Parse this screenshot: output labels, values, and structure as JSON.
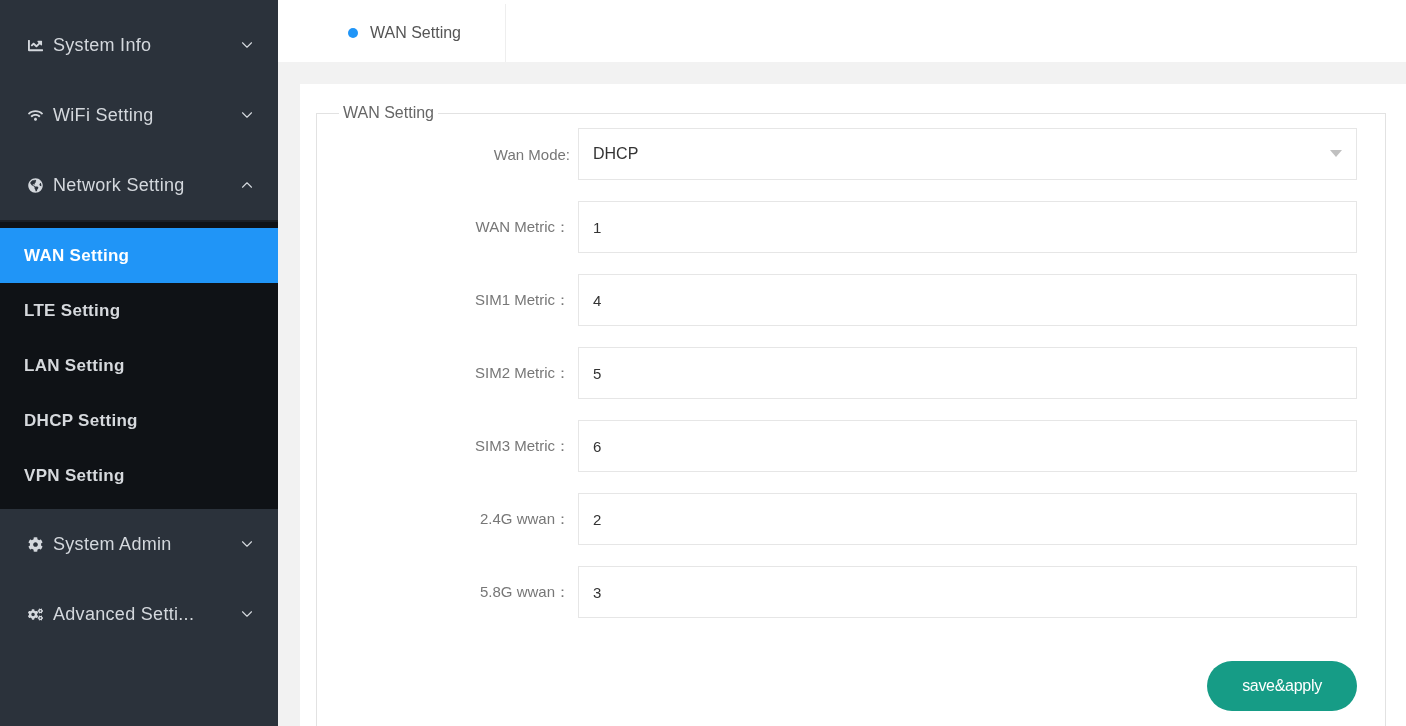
{
  "sidebar": {
    "items": [
      {
        "label": "System Info",
        "expanded": false
      },
      {
        "label": "WiFi Setting",
        "expanded": false
      },
      {
        "label": "Network Setting",
        "expanded": true,
        "children": [
          {
            "label": "WAN Setting",
            "selected": true
          },
          {
            "label": "LTE Setting",
            "selected": false
          },
          {
            "label": "LAN Setting",
            "selected": false
          },
          {
            "label": "DHCP Setting",
            "selected": false
          },
          {
            "label": "VPN Setting",
            "selected": false
          }
        ]
      },
      {
        "label": "System Admin",
        "expanded": false
      },
      {
        "label": "Advanced Setti...",
        "expanded": false
      }
    ]
  },
  "tabs": [
    {
      "label": "WAN Setting",
      "selected": true
    }
  ],
  "form": {
    "legend": "WAN Setting",
    "fields": [
      {
        "kind": "select",
        "label": "Wan Mode:",
        "value": "DHCP"
      },
      {
        "kind": "text",
        "label": "WAN Metric：",
        "value": "1"
      },
      {
        "kind": "text",
        "label": "SIM1 Metric：",
        "value": "4"
      },
      {
        "kind": "text",
        "label": "SIM2 Metric：",
        "value": "5"
      },
      {
        "kind": "text",
        "label": "SIM3 Metric：",
        "value": "6"
      },
      {
        "kind": "text",
        "label": "2.4G wwan：",
        "value": "2"
      },
      {
        "kind": "text",
        "label": "5.8G wwan：",
        "value": "3"
      }
    ],
    "button": "save&apply"
  }
}
